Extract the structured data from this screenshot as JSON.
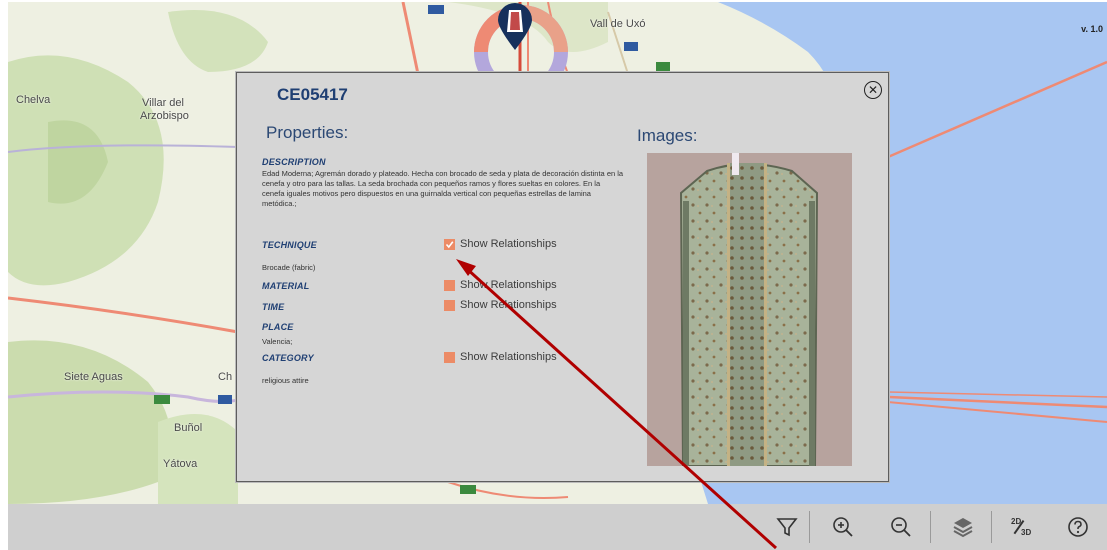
{
  "version": "v. 1.0",
  "map_labels": {
    "vall_de_uxo": "Vall de Uxó",
    "chelva": "Chelva",
    "villar_del": "Villar del",
    "arzobispo": "Arzobispo",
    "siete_aguas": "Siete Aguas",
    "ch": "Ch",
    "bunol": "Buñol",
    "yatova": "Yátova"
  },
  "modal": {
    "title": "CE05417",
    "properties_heading": "Properties:",
    "images_heading": "Images:",
    "fields": {
      "description_label": "DESCRIPTION",
      "description_value": "Edad Moderna; Agremán dorado y plateado. Hecha con brocado de seda y plata de decoración distinta en la cenefa y otro para las tallas. La seda brochada con pequeños ramos y flores sueltas en colores. En la cenefa iguales motivos pero dispuestos en una guirnalda vertical con pequeñas estrellas de lamina metódica.;",
      "technique_label": "TECHNIQUE",
      "technique_value": "Brocade (fabric)",
      "material_label": "MATERIAL",
      "time_label": "TIME",
      "place_label": "PLACE",
      "place_value": "Valencia;",
      "category_label": "CATEGORY",
      "category_value": "religious attire"
    },
    "show_relationships": {
      "technique": {
        "label": "Show Relationships",
        "checked": true
      },
      "material": {
        "label": "Show Relationships",
        "checked": false
      },
      "time": {
        "label": "Show Relationships",
        "checked": false
      },
      "category": {
        "label": "Show Relationships",
        "checked": false
      }
    }
  },
  "toolbar": {
    "icons": [
      "filter-icon",
      "zoom-in-icon",
      "zoom-out-icon",
      "layers-icon",
      "2d-3d-icon",
      "help-icon"
    ],
    "toggle_top": "2D",
    "toggle_bottom": "3D"
  },
  "colors": {
    "accent_checkbox": "#ec8b66",
    "title_blue": "#1f3f73",
    "annotation_arrow": "#b00000",
    "sea": "#a8c6f2"
  }
}
